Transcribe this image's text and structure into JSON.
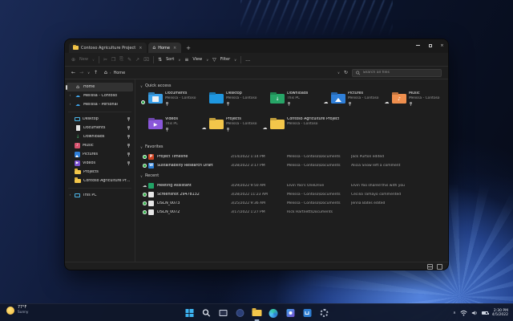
{
  "icons": {
    "home": "⌂",
    "cloud": "☁",
    "back": "←",
    "forward": "→",
    "up": "↑",
    "refresh": "↻",
    "chevron_down": "∨",
    "chevron_right": "›",
    "chevron_up": "∧",
    "new": "⊕",
    "cut": "✂",
    "copy": "❐",
    "paste": "⎘",
    "rename": "✎",
    "share": "↗",
    "delete": "⌧",
    "sort": "⇅",
    "view": "≡",
    "filter": "▽",
    "more": "…",
    "close": "×",
    "plus": "+",
    "download_arrow": "↓",
    "music_note": "♪",
    "play": "▶"
  },
  "window": {
    "tabs": [
      {
        "label": "Contoso Agriculture Project"
      },
      {
        "label": "Home"
      }
    ],
    "toolbar": {
      "new": "New",
      "sort": "Sort",
      "view": "View",
      "filter": "Filter"
    },
    "address": {
      "breadcrumb_home": "Home",
      "search_placeholder": "Search all files"
    },
    "sidebar": {
      "items": [
        {
          "label": "Home"
        },
        {
          "label": "Melissa - Contoso"
        },
        {
          "label": "Melissa - Personal"
        },
        {
          "label": "Desktop"
        },
        {
          "label": "Documents"
        },
        {
          "label": "Downloads"
        },
        {
          "label": "Music"
        },
        {
          "label": "Pictures"
        },
        {
          "label": "Videos"
        },
        {
          "label": "Projects"
        },
        {
          "label": "Contoso Agriculture Project"
        },
        {
          "label": "This PC"
        }
      ]
    },
    "sections": {
      "quick_access": {
        "title": "Quick access",
        "items": [
          {
            "name": "Documents",
            "location": "Melissa - Contoso"
          },
          {
            "name": "Desktop",
            "location": "Melissa - Contoso"
          },
          {
            "name": "Downloads",
            "location": "This PC"
          },
          {
            "name": "Pictures",
            "location": "Melissa - Contoso"
          },
          {
            "name": "Music",
            "location": "Melissa - Contoso"
          },
          {
            "name": "Videos",
            "location": "This PC"
          },
          {
            "name": "Projects",
            "location": "Melissa - Contoso"
          },
          {
            "name": "Contoso Agriculture Project",
            "location": "Melissa - Contoso"
          }
        ]
      },
      "favorites": {
        "title": "Favorites",
        "rows": [
          {
            "name": "Project Timeline",
            "date": "2/14/2022 1:14 PM",
            "location": "Melissa - Contoso\\Documents",
            "activity": "Jack Purton edited",
            "type_letter": "P"
          },
          {
            "name": "Sustainability Research Draft",
            "date": "3/28/2022 3:17 PM",
            "location": "Melissa - Contoso\\Documents",
            "activity": "Alicia Snow left a comment",
            "type_letter": "W"
          }
        ]
      },
      "recent": {
        "title": "Recent",
        "rows": [
          {
            "name": "Meeting Assistant",
            "date": "3/29/2022 9:50 AM",
            "location": "Elvin Yoo's OneDrive",
            "activity": "Elvin Yoo shared this with you"
          },
          {
            "name": "Screenshot 29478132",
            "date": "3/28/2022 11:23 AM",
            "location": "Melissa - Contoso\\Documents",
            "activity": "Cecilia Tamayo commented"
          },
          {
            "name": "DSCN_0073",
            "date": "3/25/2022 9:36 AM",
            "location": "Melissa - Contoso\\Documents",
            "activity": "Jenna Bates edited"
          },
          {
            "name": "DSCN_0072",
            "date": "3/17/2022 1:27 PM",
            "location": "Rick Hartnett\\Documents",
            "activity": ""
          }
        ]
      }
    }
  },
  "taskbar": {
    "weather": {
      "temperature": "77°F",
      "condition": "Sunny"
    },
    "icons": [
      "start",
      "search",
      "task-view",
      "chat",
      "file-explorer",
      "edge",
      "photos",
      "store",
      "settings"
    ],
    "tray": {
      "time": "2:30 PM",
      "date": "4/5/2022"
    }
  }
}
